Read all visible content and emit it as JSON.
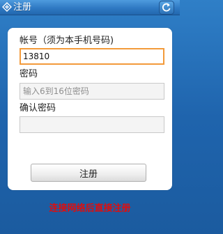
{
  "titlebar": {
    "title": "注册",
    "app_icon": "app-logo-icon",
    "back_icon": "back-arrow-icon"
  },
  "form": {
    "account_label": "帐号（须为本手机号码)",
    "account_value": "13810",
    "password_label": "密码",
    "password_placeholder": "输入6到16位密码",
    "confirm_label": "确认密码",
    "confirm_value": "",
    "submit_label": "注册"
  },
  "footer": {
    "note": "连接网络后直接注册"
  },
  "colors": {
    "titlebar": "#2f79c3",
    "background": "#1f64ad",
    "focus_border": "#f39a3a",
    "note_text": "#e00d0d"
  }
}
